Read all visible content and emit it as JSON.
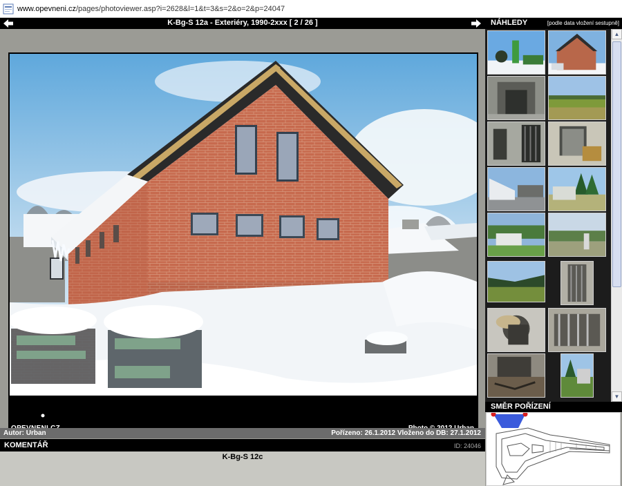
{
  "browser": {
    "url_host": "www.opevneni.cz",
    "url_path": "/pages/photoviewer.asp?i=2628&l=1&t=3&s=2&o=2&p=24047"
  },
  "viewer": {
    "title": "K-Bg-S 12a - Exteriéry, 1990-2xxx [ 2 / 26 ]",
    "brand": "OPEVNENI.CZ",
    "credit": "Photo © 2012 Urban"
  },
  "info": {
    "author": "Autor: Urban",
    "dates": "Pořízeno: 26.1.2012   Vloženo do DB: 27.1.2012"
  },
  "comment": {
    "label": "KOMENTÁŘ",
    "id": "ID: 24046",
    "text": "K-Bg-S 12c"
  },
  "thumbnails": {
    "label": "NÁHLEDY",
    "sort": "[podle data vložení sestupně]"
  },
  "direction": {
    "label": "SMĚR POŘÍZENÍ"
  },
  "colors": {
    "accent_blue": "#3b5bdc",
    "marker_red": "#d81e1e"
  }
}
